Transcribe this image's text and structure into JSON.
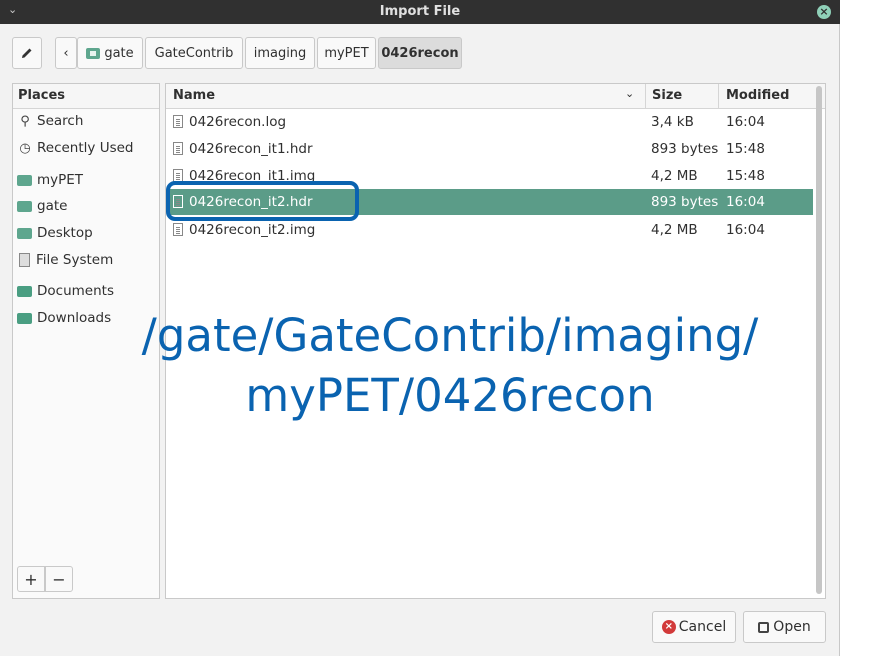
{
  "titlebar": {
    "title": "Import File",
    "menu_icon": "chevron-down-icon",
    "close_icon": "close-icon"
  },
  "toolbar": {
    "edit_icon": "pencil-icon",
    "back_icon": "chevron-left-icon",
    "breadcrumbs": [
      {
        "label": "gate",
        "icon": "home-folder-icon"
      },
      {
        "label": "GateContrib"
      },
      {
        "label": "imaging"
      },
      {
        "label": "myPET"
      },
      {
        "label": "0426recon",
        "active": true
      }
    ]
  },
  "sidebar": {
    "header": "Places",
    "items": [
      {
        "label": "Search",
        "icon": "search-icon"
      },
      {
        "label": "Recently Used",
        "icon": "clock-icon"
      },
      {
        "label": "myPET",
        "icon": "folder-icon"
      },
      {
        "label": "gate",
        "icon": "home-folder-icon"
      },
      {
        "label": "Desktop",
        "icon": "desktop-folder-icon"
      },
      {
        "label": "File System",
        "icon": "drive-icon"
      },
      {
        "label": "Documents",
        "icon": "documents-folder-icon"
      },
      {
        "label": "Downloads",
        "icon": "downloads-folder-icon"
      }
    ],
    "add_label": "+",
    "remove_label": "−"
  },
  "filelist": {
    "columns": {
      "name": "Name",
      "size": "Size",
      "modified": "Modified"
    },
    "files": [
      {
        "name": "0426recon.log",
        "size": "3,4 kB",
        "modified": "16:04",
        "selected": false
      },
      {
        "name": "0426recon_it1.hdr",
        "size": "893 bytes",
        "modified": "15:48",
        "selected": false
      },
      {
        "name": "0426recon_it1.img",
        "size": "4,2 MB",
        "modified": "15:48",
        "selected": false
      },
      {
        "name": "0426recon_it2.hdr",
        "size": "893 bytes",
        "modified": "16:04",
        "selected": true
      },
      {
        "name": "0426recon_it2.img",
        "size": "4,2 MB",
        "modified": "16:04",
        "selected": false
      }
    ]
  },
  "overlay": {
    "line1": "/gate/GateContrib/imaging/",
    "line2": "myPET/0426recon"
  },
  "buttons": {
    "cancel": "Cancel",
    "open": "Open"
  },
  "colors": {
    "selection": "#5b9c88",
    "annotation": "#0a63b0",
    "titlebar": "#303030"
  }
}
